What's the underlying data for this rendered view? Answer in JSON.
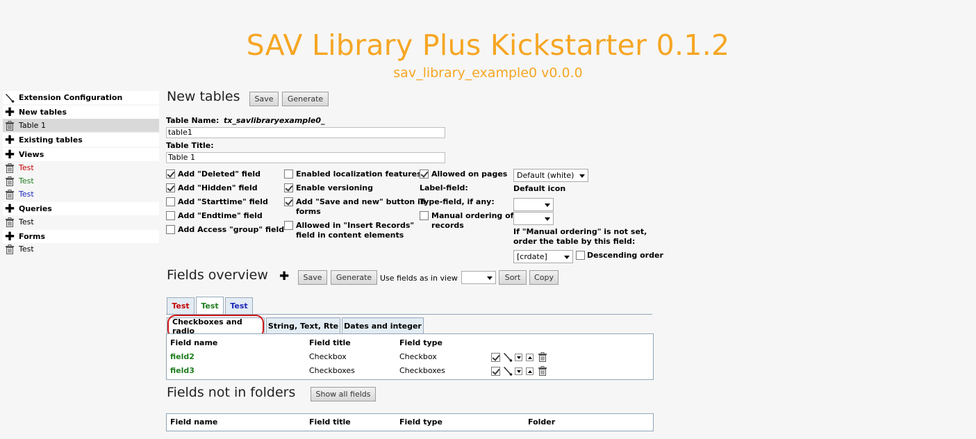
{
  "header": {
    "title": "SAV Library Plus Kickstarter 0.1.2",
    "subtitle": "sav_library_example0 v0.0.0"
  },
  "sidebar": {
    "items": [
      {
        "label": "Extension Configuration",
        "icon": "wrench-icon"
      },
      {
        "label": "New tables",
        "icon": "plus-icon"
      },
      {
        "label": "Table 1",
        "icon": "trash-icon"
      },
      {
        "label": "Existing tables",
        "icon": "plus-icon"
      },
      {
        "label": "Views",
        "icon": "plus-icon"
      },
      {
        "label": "Test",
        "icon": "trash-icon",
        "color": "#c40000"
      },
      {
        "label": "Test",
        "icon": "trash-icon",
        "color": "#1e7c1e"
      },
      {
        "label": "Test",
        "icon": "trash-icon",
        "color": "#1a27b8"
      },
      {
        "label": "Queries",
        "icon": "plus-icon"
      },
      {
        "label": "Test",
        "icon": "trash-icon"
      },
      {
        "label": "Forms",
        "icon": "plus-icon"
      },
      {
        "label": "Test",
        "icon": "trash-icon"
      }
    ]
  },
  "new_tables": {
    "heading": "New tables",
    "save_label": "Save",
    "generate_label": "Generate",
    "table_name_label": "Table Name:",
    "table_name_prefix": "tx_savlibraryexample0_",
    "table_name_value": "table1",
    "table_title_label": "Table Title:",
    "table_title_value": "Table 1",
    "checkboxes_col1": [
      {
        "label": "Add \"Deleted\" field",
        "checked": true
      },
      {
        "label": "Add \"Hidden\" field",
        "checked": true
      },
      {
        "label": "Add \"Starttime\" field",
        "checked": false
      },
      {
        "label": "Add \"Endtime\" field",
        "checked": false
      },
      {
        "label": "Add Access \"group\" field",
        "checked": false
      }
    ],
    "checkboxes_col2": [
      {
        "label": "Enabled localization features",
        "checked": false
      },
      {
        "label": "Enable versioning",
        "checked": true
      },
      {
        "label_line1": "Add \"Save and new\" button in",
        "label_line2": "forms",
        "checked": true
      },
      {
        "label_line1": "Allowed in \"Insert Records\"",
        "label_line2": "field in content elements",
        "checked": false
      }
    ],
    "allowed_on_pages_label": "Allowed on pages",
    "allowed_on_pages_checked": true,
    "label_field_label": "Label-field:",
    "type_field_label": "Type-field, if any:",
    "manual_ordering_line1": "Manual ordering of",
    "manual_ordering_line2": "records",
    "manual_ordering_checked": false,
    "default_select_value": "Default (white)",
    "default_icon_label": "Default icon",
    "ordering_note_line1": "If \"Manual ordering\" is not set,",
    "ordering_note_line2": "order the table by this field:",
    "order_field_value": "[crdate]",
    "descending_label": "Descending order",
    "descending_checked": false
  },
  "fields_overview": {
    "heading": "Fields overview",
    "save_label": "Save",
    "generate_label": "Generate",
    "use_fields_label": "Use fields as in view",
    "sort_label": "Sort",
    "copy_label": "Copy",
    "view_tabs": [
      {
        "label": "Test",
        "color": "#c40000"
      },
      {
        "label": "Test",
        "color": "#1e7c1e"
      },
      {
        "label": "Test",
        "color": "#1a27b8"
      }
    ],
    "folder_tabs": [
      "Checkboxes and radio",
      "String, Text, Rte",
      "Dates and integer"
    ],
    "columns": [
      "Field name",
      "Field title",
      "Field type"
    ],
    "rows": [
      {
        "name": "field2",
        "title": "Checkbox",
        "type": "Checkbox"
      },
      {
        "name": "field3",
        "title": "Checkboxes",
        "type": "Checkboxes"
      }
    ]
  },
  "fields_not_in_folders": {
    "heading": "Fields not in folders",
    "show_all_label": "Show all fields",
    "columns": [
      "Field name",
      "Field title",
      "Field type",
      "Folder"
    ]
  }
}
